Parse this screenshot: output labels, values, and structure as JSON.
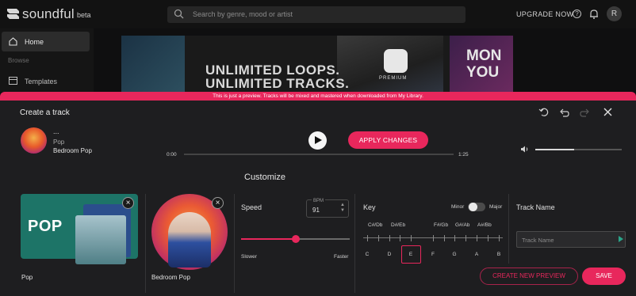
{
  "app": {
    "name": "soundful",
    "badge": "beta"
  },
  "header": {
    "search_placeholder": "Search by genre, mood or artist",
    "upgrade_label": "UPGRADE NOW",
    "help_glyph": "?",
    "avatar_initial": "R"
  },
  "sidebar": {
    "items": [
      {
        "label": "Home",
        "icon": "home-icon"
      },
      {
        "label": "Browse"
      },
      {
        "label": "Templates",
        "icon": "templates-icon"
      }
    ]
  },
  "banner": {
    "line1": "UNLIMITED LOOPS.",
    "line2": "UNLIMITED TRACKS.",
    "premium_label": "PREMIUM",
    "side_text_1": "MON",
    "side_text_2": "YOU"
  },
  "notice": "This is just a preview. Tracks will be mixed and mastered when downloaded from My Library.",
  "panel": {
    "title": "Create a track",
    "now_playing": {
      "title": "...",
      "genre": "Pop",
      "template": "Bedroom Pop"
    },
    "apply_label": "APPLY CHANGES",
    "time_current": "0:00",
    "time_total": "1:25",
    "progress": 0,
    "volume": 0.45,
    "customize_label": "Customize",
    "cards": [
      {
        "label": "Pop",
        "art_text": "POP",
        "close": "×"
      },
      {
        "label": "Bedroom Pop",
        "close": "×"
      }
    ],
    "speed": {
      "label": "Speed",
      "bpm_label": "BPM",
      "bpm_value": "91",
      "slow_label": "Slower",
      "fast_label": "Faster",
      "position": 0.5
    },
    "key": {
      "label": "Key",
      "minor_label": "Minor",
      "major_label": "Major",
      "mode": "minor",
      "sharps": [
        "C#/Db",
        "D#/Eb",
        "F#/Gb",
        "G#/Ab",
        "A#/Bb"
      ],
      "naturals": [
        "C",
        "D",
        "E",
        "F",
        "G",
        "A",
        "B"
      ],
      "selected": "E"
    },
    "track_name": {
      "label": "Track Name",
      "placeholder": "Track Name"
    },
    "create_preview_label": "CREATE NEW PREVIEW",
    "save_label": "SAVE"
  },
  "colors": {
    "accent": "#e8275c",
    "background": "#0f0f10",
    "panel": "#1e1e20"
  }
}
